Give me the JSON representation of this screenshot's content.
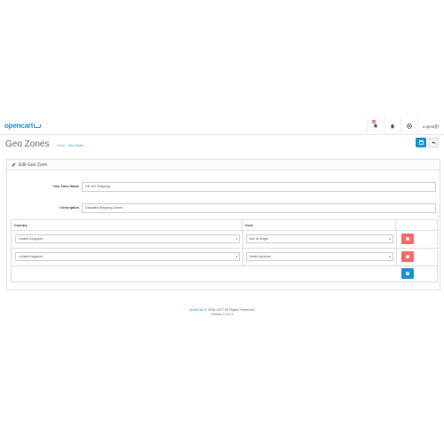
{
  "header": {
    "logo_text": "opencart",
    "notification_count": "9",
    "logout_label": "Logout"
  },
  "page": {
    "title": "Geo Zones",
    "breadcrumb": [
      "Home",
      "Geo Zones"
    ]
  },
  "panel": {
    "heading": "Edit Geo Zone"
  },
  "form": {
    "name_label": "Geo Zone Name",
    "name_value": "UK NO Shipping",
    "description_label": "Description",
    "description_value": "Disabled Shipping Zones"
  },
  "zone_table": {
    "headers": [
      "Country",
      "Zone"
    ],
    "rows": [
      {
        "country": "United Kingdom",
        "zone": "Isle of Wight"
      },
      {
        "country": "United Kingdom",
        "zone": "North Ayrshire"
      }
    ]
  },
  "footer": {
    "link_text": "OpenCart",
    "copyright": "© 2009-2017 All Rights Reserved.",
    "version": "Version 2.3.0.2"
  },
  "colors": {
    "primary": "#1e91cf",
    "danger": "#f56b6b"
  },
  "icons": [
    "cart-icon",
    "bell-icon",
    "home-icon",
    "lifebuoy-icon",
    "signout-icon",
    "save-icon",
    "reply-icon",
    "pencil-icon",
    "minus-circle-icon",
    "plus-circle-icon"
  ]
}
